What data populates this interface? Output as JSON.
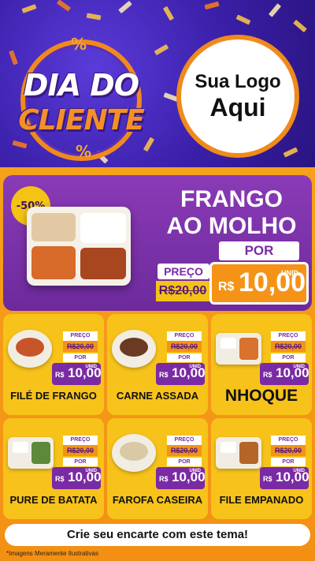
{
  "header": {
    "badge_line1": "DIA DO",
    "badge_line2": "CLIENTE",
    "percent_symbol": "%",
    "logo_line1": "Sua Logo",
    "logo_line2": "Aqui"
  },
  "featured": {
    "discount": "-50%",
    "title_line1": "FRANGO",
    "title_line2": "AO MOLHO",
    "por_label": "POR",
    "preco_label": "PREÇO",
    "old_price": "R$20,00",
    "currency": "R$",
    "new_price": "10,00",
    "unit_label": "UNID"
  },
  "products": [
    {
      "name": "FILÉ DE FRANGO",
      "preco_label": "PREÇO",
      "old_price": "R$20,00",
      "por_label": "POR",
      "currency": "R$",
      "price": "10,00",
      "unit_label": "UNID"
    },
    {
      "name": "CARNE ASSADA",
      "preco_label": "PREÇO",
      "old_price": "R$20,00",
      "por_label": "POR",
      "currency": "R$",
      "price": "10,00",
      "unit_label": "UNID"
    },
    {
      "name": "NHOQUE",
      "preco_label": "PREÇO",
      "old_price": "R$20,00",
      "por_label": "POR",
      "currency": "R$",
      "price": "10,00",
      "unit_label": "UNID"
    },
    {
      "name": "PURE DE BATATA",
      "preco_label": "PREÇO",
      "old_price": "R$20,00",
      "por_label": "POR",
      "currency": "R$",
      "price": "10,00",
      "unit_label": "UNID"
    },
    {
      "name": "FAROFA CASEIRA",
      "preco_label": "PREÇO",
      "old_price": "R$20,00",
      "por_label": "POR",
      "currency": "R$",
      "price": "10,00",
      "unit_label": "UNID"
    },
    {
      "name": "FILE EMPANADO",
      "preco_label": "PREÇO",
      "old_price": "R$20,00",
      "por_label": "POR",
      "currency": "R$",
      "price": "10,00",
      "unit_label": "UNID"
    }
  ],
  "cta_text": "Crie seu encarte com este tema!",
  "footnote": "*Imagens Meramente Ilustrativas",
  "colors": {
    "purple": "#7a2aa4",
    "orange": "#f59317",
    "yellow": "#f7c21a",
    "header_blue": "#3a1fa8"
  }
}
